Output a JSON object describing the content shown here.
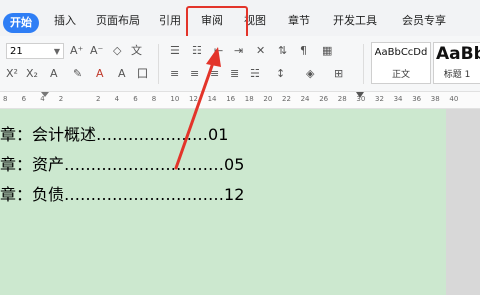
{
  "ribbon": {
    "tabs": [
      {
        "label": "开始",
        "active": true
      },
      {
        "label": "插入"
      },
      {
        "label": "页面布局"
      },
      {
        "label": "引用"
      },
      {
        "label": "审阅",
        "highlighted": true
      },
      {
        "label": "视图"
      },
      {
        "label": "章节"
      },
      {
        "label": "开发工具"
      },
      {
        "label": "会员专享"
      }
    ]
  },
  "toolbar": {
    "font_size": "21",
    "styles": [
      {
        "sample": "AaBbCcDd",
        "label": "正文"
      },
      {
        "sample": "AaBb",
        "label": "标题 1"
      }
    ]
  },
  "ruler": {
    "numbers": [
      "8",
      "6",
      "4",
      "2",
      "",
      "2",
      "4",
      "6",
      "8",
      "10",
      "12",
      "14",
      "16",
      "18",
      "20",
      "22",
      "24",
      "26",
      "28",
      "30",
      "32",
      "34",
      "36",
      "38",
      "40"
    ]
  },
  "document": {
    "lines": [
      {
        "title": "章：会计概述",
        "page": "01"
      },
      {
        "title": "章：资产",
        "page": "05"
      },
      {
        "title": "章：负债",
        "page": "12"
      }
    ]
  },
  "colors": {
    "accent": "#2f7ef5",
    "highlight": "#e3342a",
    "doc_background": "#cce8cf"
  }
}
